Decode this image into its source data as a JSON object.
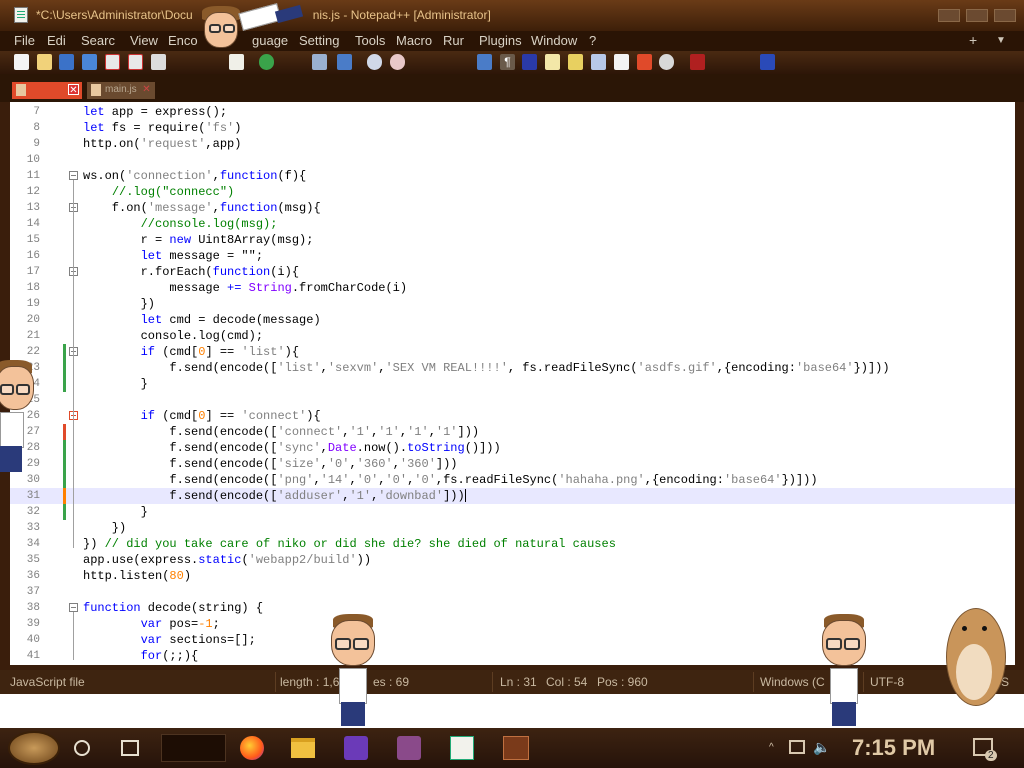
{
  "window": {
    "title": "*C:\\Users\\Administrator\\Docu... ...nis.js - Notepad++ [Administrator]",
    "title_left": "*C:\\Users\\Administrator\\Docu",
    "title_right": "nis.js - Notepad++ [Administrator]"
  },
  "menu": {
    "items": [
      "File",
      "Edit",
      "Search",
      "View",
      "Encoding",
      "Language",
      "Settings",
      "Tools",
      "Macro",
      "Run",
      "Plugins",
      "Window",
      "?"
    ],
    "items_visible": [
      "File",
      "Edi",
      "Searc",
      "View",
      "Enco",
      "guage",
      "Setting",
      "Tools",
      "Macro",
      "Rur",
      "Plugins",
      "Window",
      "?"
    ],
    "plus": "+",
    "dropdown": "▼",
    "close": "✕"
  },
  "tabs": [
    {
      "label": "",
      "active": true
    },
    {
      "label": "main.js",
      "active": false
    }
  ],
  "editor": {
    "lines": [
      {
        "n": "7",
        "html": "<span class=\"kw\">let</span> app = express();"
      },
      {
        "n": "8",
        "html": "<span class=\"kw\">let</span> fs = require(<span class=\"str\">'fs'</span>)"
      },
      {
        "n": "9",
        "html": "http.on(<span class=\"str\">'request'</span>,app)"
      },
      {
        "n": "10",
        "html": ""
      },
      {
        "n": "11",
        "html": "ws.on(<span class=\"str\">'connection'</span>,<span class=\"kw\">function</span>(f){"
      },
      {
        "n": "12",
        "html": "    <span class=\"cm\">//.log(\"connecc\")</span>"
      },
      {
        "n": "13",
        "html": "    f.on(<span class=\"str\">'message'</span>,<span class=\"kw\">function</span>(msg){"
      },
      {
        "n": "14",
        "html": "        <span class=\"cm\">//console.log(msg);</span>"
      },
      {
        "n": "15",
        "html": "        r = <span class=\"kw\">new</span> Uint8Array(msg);"
      },
      {
        "n": "16",
        "html": "        <span class=\"kw\">let</span> message = \"\";"
      },
      {
        "n": "17",
        "html": "        r.forEach(<span class=\"kw\">function</span>(i){"
      },
      {
        "n": "18",
        "html": "            message <span class=\"kw\">+=</span> <span class=\"obj\">String</span>.fromCharCode(i)"
      },
      {
        "n": "19",
        "html": "        })"
      },
      {
        "n": "20",
        "html": "        <span class=\"kw\">let</span> cmd = decode(message)"
      },
      {
        "n": "21",
        "html": "        console.log(cmd);"
      },
      {
        "n": "22",
        "html": "        <span class=\"kw\">if</span> (cmd[<span class=\"num\">0</span>] == <span class=\"str\">'list'</span>){"
      },
      {
        "n": "23",
        "html": "            f.send(encode([<span class=\"str\">'list'</span>,<span class=\"str\">'sexvm'</span>,<span class=\"str\">'SEX VM REAL!!!!'</span>, fs.readFileSync(<span class=\"str\">'asdfs.gif'</span>,{encoding:<span class=\"str\">'base64'</span>})]))"
      },
      {
        "n": "24",
        "html": "        }"
      },
      {
        "n": "25",
        "html": ""
      },
      {
        "n": "26",
        "html": "        <span class=\"kw\">if</span> (cmd[<span class=\"num\">0</span>] == <span class=\"str\">'connect'</span>){"
      },
      {
        "n": "27",
        "html": "            f.send(encode([<span class=\"str\">'connect'</span>,<span class=\"str\">'1'</span>,<span class=\"str\">'1'</span>,<span class=\"str\">'1'</span>,<span class=\"str\">'1'</span>]))"
      },
      {
        "n": "28",
        "html": "            f.send(encode([<span class=\"str\">'sync'</span>,<span class=\"obj\">Date</span>.now().<span class=\"kw\">toString</span>()]))"
      },
      {
        "n": "29",
        "html": "            f.send(encode([<span class=\"str\">'size'</span>,<span class=\"str\">'0'</span>,<span class=\"str\">'360'</span>,<span class=\"str\">'360'</span>]))"
      },
      {
        "n": "30",
        "html": "            f.send(encode([<span class=\"str\">'png'</span>,<span class=\"str\">'14'</span>,<span class=\"str\">'0'</span>,<span class=\"str\">'0'</span>,<span class=\"str\">'0'</span>,fs.readFileSync(<span class=\"str\">'hahaha.png'</span>,{encoding:<span class=\"str\">'base64'</span>})]))"
      },
      {
        "n": "31",
        "html": "            f.send(encode([<span class=\"str\">'adduser'</span>,<span class=\"str\">'1'</span>,<span class=\"str\">'downbad'</span>]))<span class=\"caret\"></span>"
      },
      {
        "n": "32",
        "html": "        }"
      },
      {
        "n": "33",
        "html": "    })"
      },
      {
        "n": "34",
        "html": "}) <span class=\"cm\">// did you take care of niko or did she die? she died of natural causes</span>"
      },
      {
        "n": "35",
        "html": "app.use(express.<span class=\"kw\">static</span>(<span class=\"str\">'webapp2/build'</span>))"
      },
      {
        "n": "36",
        "html": "http.listen(<span class=\"num\">80</span>)"
      },
      {
        "n": "37",
        "html": ""
      },
      {
        "n": "38",
        "html": "<span class=\"kw\">function</span> decode(string) {"
      },
      {
        "n": "39",
        "html": "        <span class=\"kw\">var</span> pos=<span class=\"num\">-1</span>;"
      },
      {
        "n": "40",
        "html": "        <span class=\"kw\">var</span> sections=[];"
      },
      {
        "n": "41",
        "html": "        <span class=\"kw\">for</span>(;;){"
      }
    ],
    "current_line": "31"
  },
  "status": {
    "type": "JavaScript file",
    "length": "length : 1,6",
    "lines": "es : 69",
    "ln": "Ln : 31",
    "col": "Col : 54",
    "pos": "Pos : 960",
    "eol": "Windows (C",
    "encoding": "UTF-8",
    "mode": "S"
  },
  "taskbar": {
    "clock": "7:15 PM",
    "notification_count": "2"
  }
}
